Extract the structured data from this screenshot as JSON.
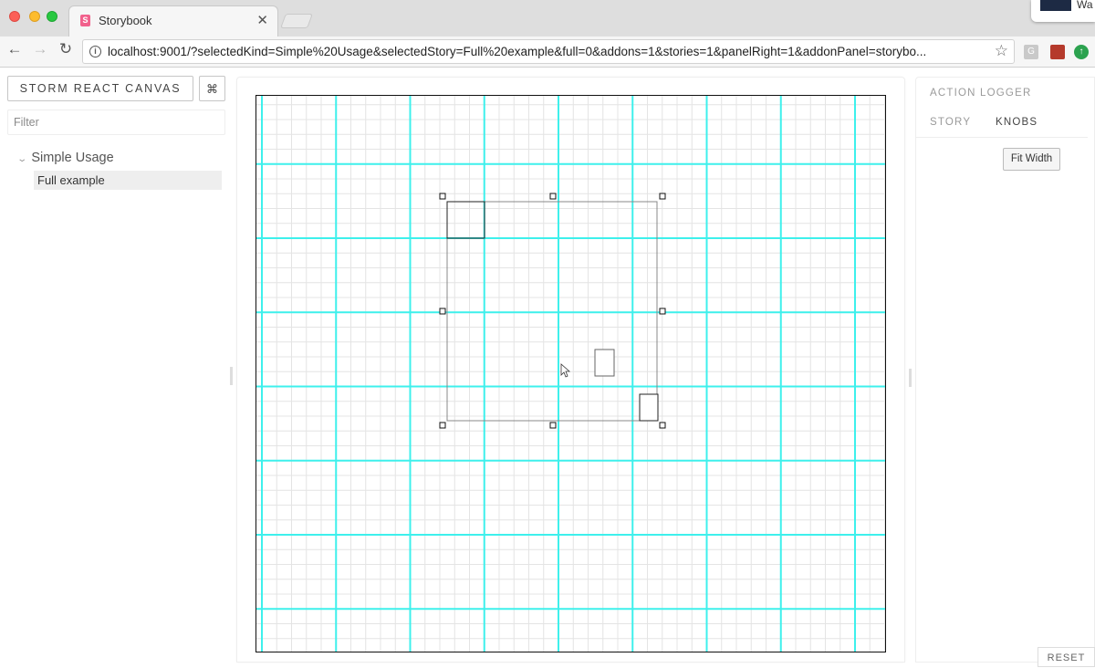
{
  "browser": {
    "tab_title": "Storybook",
    "tab_favicon": "S",
    "close_glyph": "✕",
    "profile_text": "Wa",
    "url": "localhost:9001/?selectedKind=Simple%20Usage&selectedStory=Full%20example&full=0&addons=1&stories=1&panelRight=1&addonPanel=storybo...",
    "icons": [
      "back-arrow-icon",
      "forward-arrow-icon",
      "reload-icon",
      "info-icon",
      "star-icon"
    ]
  },
  "sidebar": {
    "brand_label": "STORM REACT CANVAS",
    "shortcut_label": "⌘",
    "filter_placeholder": "Filter",
    "kinds": [
      {
        "label": "Simple Usage",
        "stories": [
          {
            "label": "Full example",
            "selected": true
          }
        ]
      }
    ]
  },
  "addon_panel": {
    "tabs": {
      "action_logger": "ACTION LOGGER",
      "story": "STORY",
      "knobs": "KNOBS"
    },
    "active_tab": "KNOBS",
    "fit_width_label": "Fit Width",
    "reset_label": "RESET"
  },
  "colors": {
    "grid_major": "#3ef0ec",
    "grid_minor": "#e4e4e4",
    "brand_favicon": "#f1618c"
  }
}
